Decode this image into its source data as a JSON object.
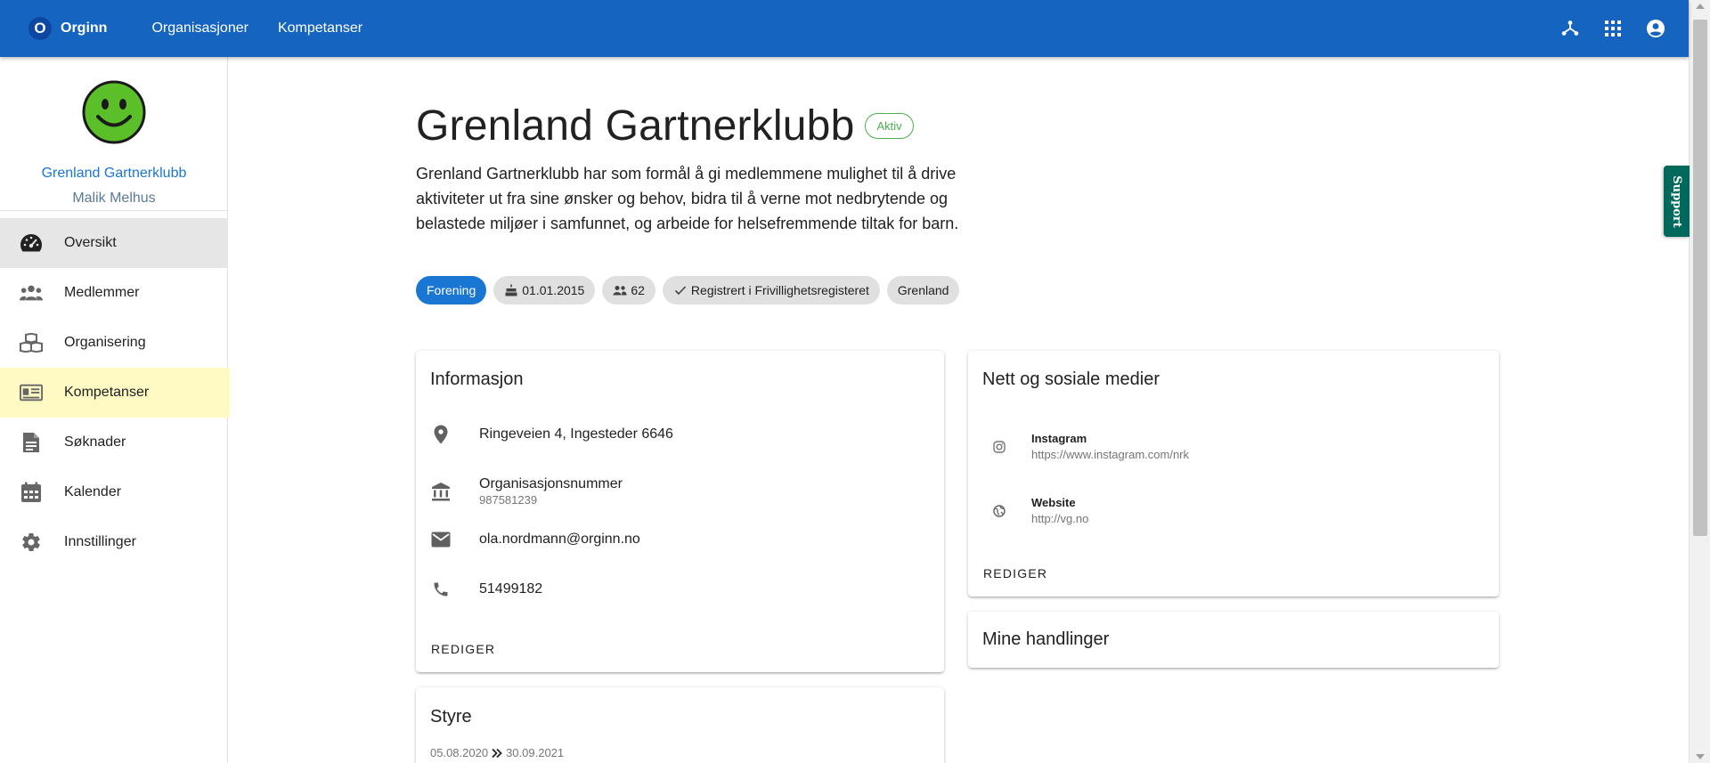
{
  "appbar": {
    "brand_letter": "O",
    "brand_name": "Orginn",
    "nav": [
      "Organisasjoner",
      "Kompetanser"
    ],
    "icons": [
      "hub-icon",
      "apps-grid-icon",
      "account-circle-icon"
    ]
  },
  "sidebar": {
    "avatar_icon": "smiley-face-icon",
    "org_name": "Grenland Gartnerklubb",
    "user_name": "Malik Melhus",
    "items": [
      {
        "label": "Oversikt",
        "icon": "speedometer-icon",
        "state": "active"
      },
      {
        "label": "Medlemmer",
        "icon": "people-icon"
      },
      {
        "label": "Organisering",
        "icon": "boxes-icon"
      },
      {
        "label": "Kompetanser",
        "icon": "id-card-icon",
        "state": "highlighted"
      },
      {
        "label": "Søknader",
        "icon": "document-icon"
      },
      {
        "label": "Kalender",
        "icon": "calendar-icon"
      },
      {
        "label": "Innstillinger",
        "icon": "gear-icon"
      }
    ]
  },
  "main": {
    "title": "Grenland Gartnerklubb",
    "status": "Aktiv",
    "description": "Grenland Gartnerklubb har som formål å gi medlemmene mulighet til å drive aktiviteter ut fra sine ønsker og behov, bidra til å verne mot nedbrytende og belastede miljøer i samfunnet, og arbeide for helsefremmende tiltak for barn.",
    "chips": [
      {
        "label": "Forening",
        "type": "primary"
      },
      {
        "label": "01.01.2015",
        "icon": "cake-icon"
      },
      {
        "label": "62",
        "icon": "people-icon"
      },
      {
        "label": "Registrert i Frivillighetsregisteret",
        "icon": "check-icon"
      },
      {
        "label": "Grenland"
      }
    ]
  },
  "info_card": {
    "title": "Informasjon",
    "address": "Ringeveien 4, Ingesteder 6646",
    "orgnr_label": "Organisasjonsnummer",
    "orgnr_value": "987581239",
    "email": "ola.nordmann@orginn.no",
    "phone": "51499182",
    "action": "REDIGER"
  },
  "social_card": {
    "title": "Nett og sosiale medier",
    "items": [
      {
        "title": "Instagram",
        "url": "https://www.instagram.com/nrk",
        "icon": "instagram-icon"
      },
      {
        "title": "Website",
        "url": "http://vg.no",
        "icon": "globe-icon"
      }
    ],
    "action": "REDIGER"
  },
  "actions_card": {
    "title": "Mine handlinger"
  },
  "board_card": {
    "title": "Styre",
    "from": "05.08.2020",
    "to": "30.09.2021"
  },
  "support_tab": "Support",
  "colors": {
    "appbar": "#1565c0",
    "primary": "#1976d2",
    "active_status": "#4caf50",
    "support": "#00695c",
    "highlight": "#fff9c4"
  }
}
